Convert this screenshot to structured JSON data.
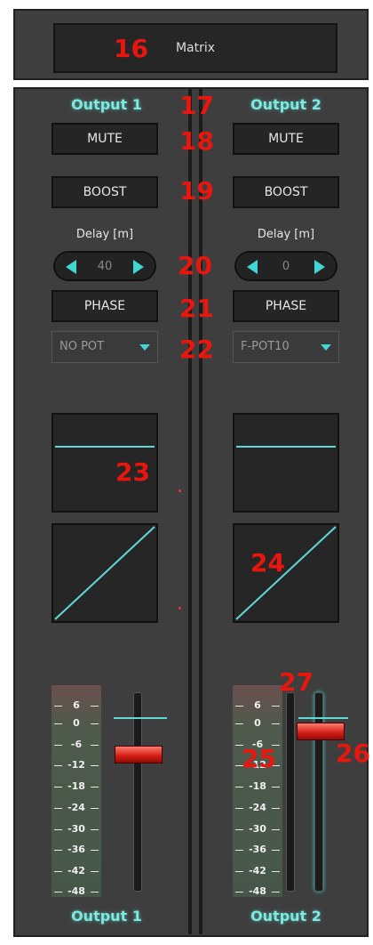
{
  "matrix": {
    "label": "Matrix"
  },
  "outputs": [
    {
      "title": "Output 1",
      "mute_label": "MUTE",
      "boost_label": "BOOST",
      "delay_label": "Delay [m]",
      "delay_value": "40",
      "phase_label": "PHASE",
      "pot_selected": "NO POT",
      "fader_level_db": -6,
      "bottom_label": "Output 1"
    },
    {
      "title": "Output 2",
      "mute_label": "MUTE",
      "boost_label": "BOOST",
      "delay_label": "Delay [m]",
      "delay_value": "0",
      "phase_label": "PHASE",
      "pot_selected": "F-POT10",
      "fader_level_db": -3,
      "bottom_label": "Output 2"
    }
  ],
  "meter_scale": [
    "6",
    "0",
    "-6",
    "-12",
    "-18",
    "-24",
    "-30",
    "-36",
    "-42",
    "-48"
  ],
  "annotations": [
    "16",
    "17",
    "18",
    "19",
    "20",
    "21",
    "22",
    "23",
    "24",
    "25",
    "26",
    "27"
  ],
  "colors": {
    "accent": "#3fd6d3",
    "annotation": "#e8160d",
    "panel": "#3e3e3e"
  }
}
